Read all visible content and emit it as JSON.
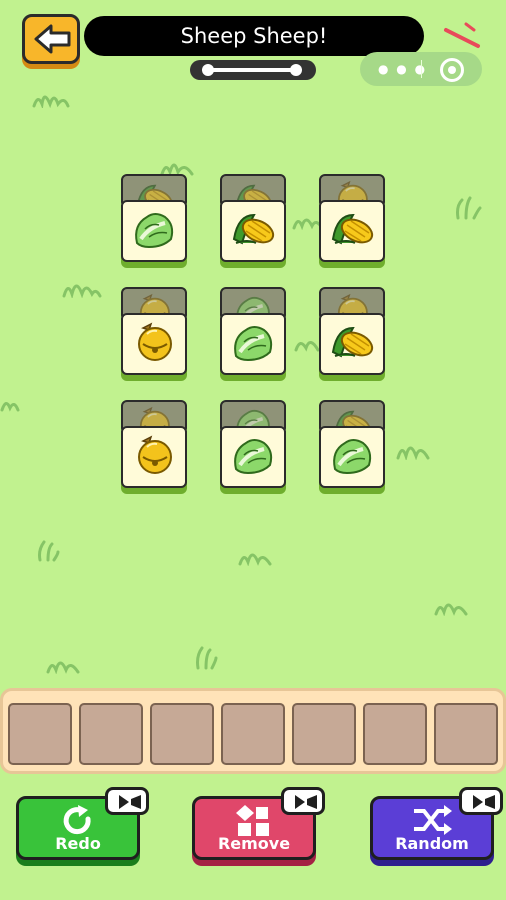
{
  "header": {
    "title": "Sheep Sheep!"
  },
  "board": {
    "tiles": [
      {
        "row": 1,
        "col": 1,
        "top": "lettuce",
        "under": "corn"
      },
      {
        "row": 1,
        "col": 2,
        "top": "corn",
        "under": "corn"
      },
      {
        "row": 1,
        "col": 3,
        "top": "corn",
        "under": "bell"
      },
      {
        "row": 2,
        "col": 1,
        "top": "bell",
        "under": "bell"
      },
      {
        "row": 2,
        "col": 2,
        "top": "lettuce",
        "under": "lettuce"
      },
      {
        "row": 2,
        "col": 3,
        "top": "corn",
        "under": "bell"
      },
      {
        "row": 3,
        "col": 1,
        "top": "bell",
        "under": "bell"
      },
      {
        "row": 3,
        "col": 2,
        "top": "lettuce",
        "under": "lettuce"
      },
      {
        "row": 3,
        "col": 3,
        "top": "lettuce",
        "under": "corn"
      }
    ]
  },
  "tray": {
    "slot_count": 7
  },
  "actions": {
    "redo_label": "Redo",
    "remove_label": "Remove",
    "random_label": "Random"
  },
  "colors": {
    "background": "#c1f28f",
    "redo": "#39c33a",
    "remove": "#e0476a",
    "random": "#5b3ed6",
    "back_button": "#f8b62a"
  }
}
